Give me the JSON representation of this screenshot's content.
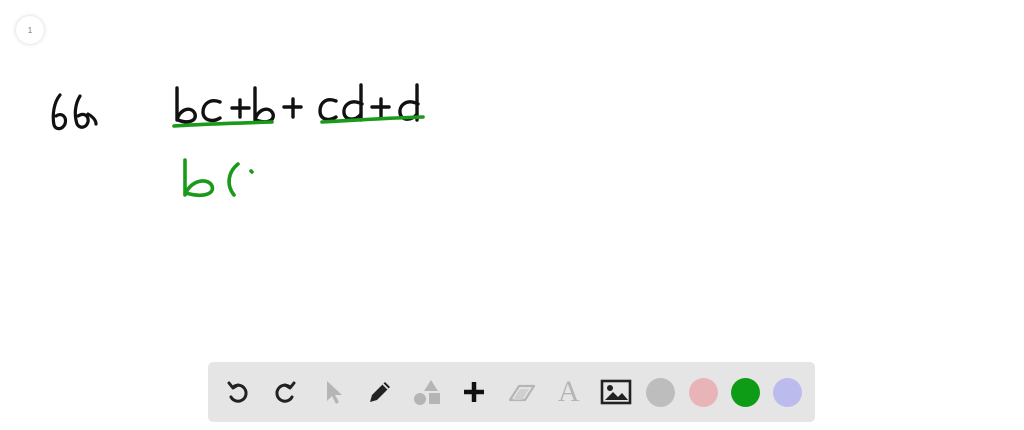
{
  "page_indicator": "1",
  "whiteboard": {
    "problem_number": "66",
    "expression": "bc + b + cd + d",
    "step": "b("
  },
  "toolbar": {
    "tools": [
      {
        "name": "undo",
        "icon": "undo-icon"
      },
      {
        "name": "redo",
        "icon": "redo-icon"
      },
      {
        "name": "select",
        "icon": "cursor-icon"
      },
      {
        "name": "pen",
        "icon": "pencil-icon"
      },
      {
        "name": "shapes",
        "icon": "shapes-icon"
      },
      {
        "name": "add",
        "icon": "plus-icon"
      },
      {
        "name": "eraser",
        "icon": "eraser-icon"
      },
      {
        "name": "text",
        "icon": "text-icon",
        "label": "A"
      },
      {
        "name": "image",
        "icon": "image-icon"
      }
    ],
    "colors": [
      "#bdbdbd",
      "#e8b4b8",
      "#0e9b16",
      "#bbbbee"
    ],
    "selected_color": "#0e9b16"
  },
  "ink_colors": {
    "black": "#111111",
    "green": "#1a9a1a"
  }
}
